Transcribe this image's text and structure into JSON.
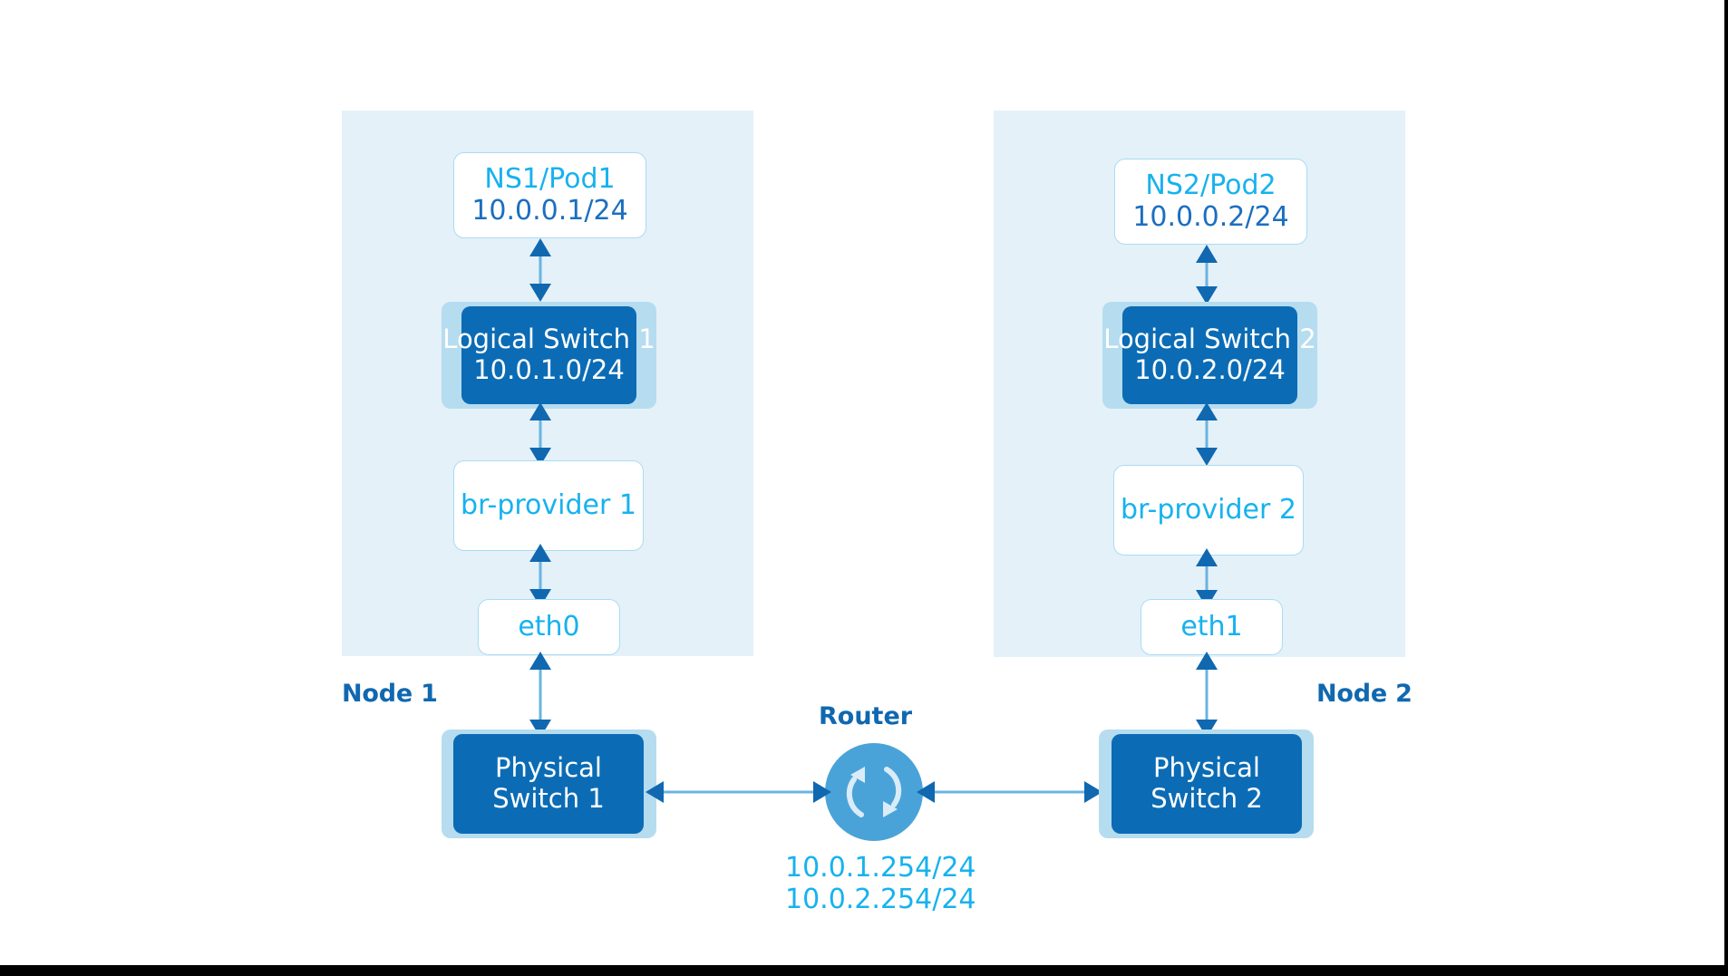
{
  "diagram": {
    "title": "Kubernetes OVN multi-node network topology",
    "colors": {
      "panel_bg": "#e4f1f8",
      "dark_blue": "#0b6cb5",
      "backdrop_blue": "#b6dcf0",
      "cyan_text": "#17b2ee",
      "dark_blue_text": "#1b6fc0",
      "label_blue": "#1068b0",
      "arrow_blue": "#1068b0",
      "arrow_shaft": "#6ab4e0",
      "router_circle": "#4aa3d8",
      "white": "#ffffff",
      "box_border": "#a8dcf5"
    },
    "nodes": [
      {
        "id": "node1",
        "label": "Node 1",
        "pod": {
          "name": "NS1/Pod1",
          "ip": "10.0.0.1/24"
        },
        "logical_switch": {
          "name": "Logical Switch 1",
          "ip": "10.0.1.0/24"
        },
        "bridge": {
          "name": "br-provider 1"
        },
        "nic": {
          "name": "eth0"
        },
        "physical_switch": {
          "line1": "Physical",
          "line2": "Switch 1"
        }
      },
      {
        "id": "node2",
        "label": "Node 2",
        "pod": {
          "name": "NS2/Pod2",
          "ip": "10.0.0.2/24"
        },
        "logical_switch": {
          "name": "Logical Switch 2",
          "ip": "10.0.2.0/24"
        },
        "bridge": {
          "name": "br-provider 2"
        },
        "nic": {
          "name": "eth1"
        },
        "physical_switch": {
          "line1": "Physical",
          "line2": "Switch 2"
        }
      }
    ],
    "router": {
      "label": "Router",
      "icon": "sync-circular-arrows-icon",
      "ips": [
        "10.0.1.254/24",
        "10.0.2.254/24"
      ]
    }
  }
}
